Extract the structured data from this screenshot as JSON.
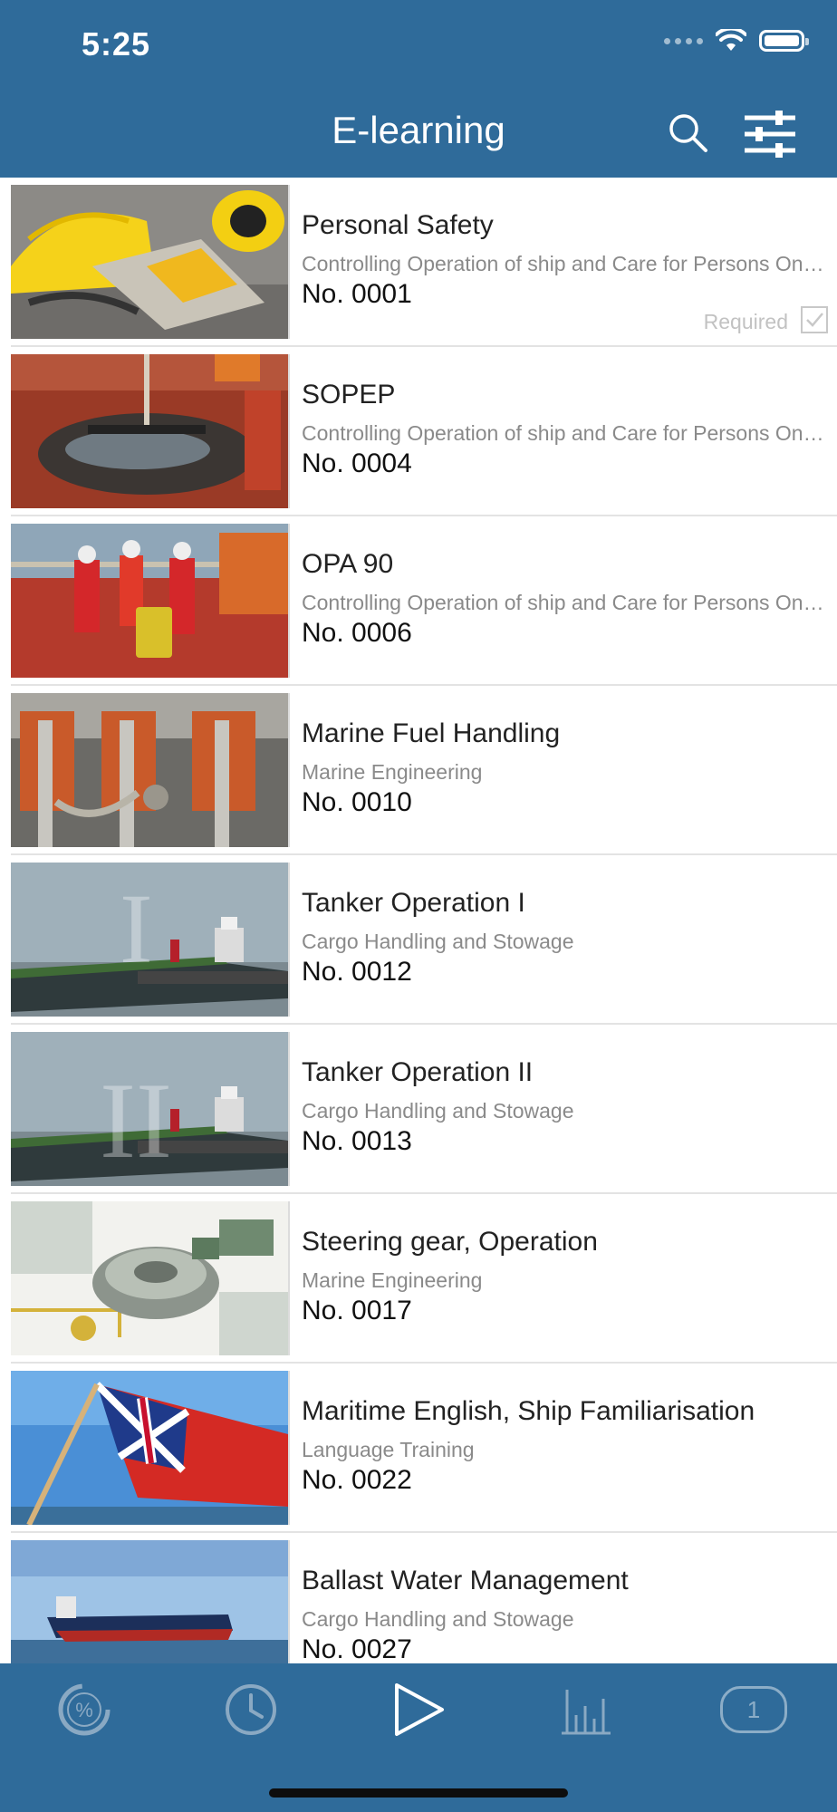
{
  "status": {
    "time": "5:25"
  },
  "nav": {
    "title": "E-learning",
    "search_icon": "search-icon",
    "filter_icon": "sliders-icon"
  },
  "courses": [
    {
      "title": "Personal Safety",
      "subtitle": "Controlling Operation of ship and Care for Persons On Board",
      "number": "No. 0001",
      "required_label": "Required",
      "required": true,
      "thumb": "safety-gear-image"
    },
    {
      "title": "SOPEP",
      "subtitle": "Controlling Operation of ship and Care for Persons On Board",
      "number": "No. 0004",
      "thumb": "oil-spill-cleanup-image"
    },
    {
      "title": "OPA 90",
      "subtitle": "Controlling Operation of ship and Care for Persons On Board",
      "number": "No. 0006",
      "thumb": "crew-on-deck-image"
    },
    {
      "title": "Marine Fuel Handling",
      "subtitle": "Marine Engineering",
      "number": "No. 0010",
      "thumb": "engine-pipes-image"
    },
    {
      "title": "Tanker Operation I",
      "subtitle": "Cargo Handling and Stowage",
      "number": "No. 0012",
      "thumb": "tanker-ship-image"
    },
    {
      "title": "Tanker Operation II",
      "subtitle": "Cargo Handling and Stowage",
      "number": "No. 0013",
      "thumb": "tanker-ship-image"
    },
    {
      "title": "Steering gear, Operation",
      "subtitle": "Marine Engineering",
      "number": "No. 0017",
      "thumb": "steering-gear-image"
    },
    {
      "title": "Maritime English, Ship Familiarisation",
      "subtitle": "Language Training",
      "number": "No. 0022",
      "thumb": "red-ensign-flag-image"
    },
    {
      "title": "Ballast Water Management",
      "subtitle": "Cargo Handling and Stowage",
      "number": "No. 0027",
      "thumb": "bulk-carrier-image"
    }
  ],
  "tabbar": {
    "tabs": [
      {
        "icon": "progress-percent-icon",
        "active": false
      },
      {
        "icon": "clock-icon",
        "active": false
      },
      {
        "icon": "play-icon",
        "active": true
      },
      {
        "icon": "bar-chart-icon",
        "active": false
      },
      {
        "icon": "badge-count-icon",
        "active": false,
        "badge": "1"
      }
    ]
  },
  "colors": {
    "accent": "#2f6b9a",
    "active_icon": "#ffffff",
    "inactive_icon": "#8aa9c3"
  }
}
